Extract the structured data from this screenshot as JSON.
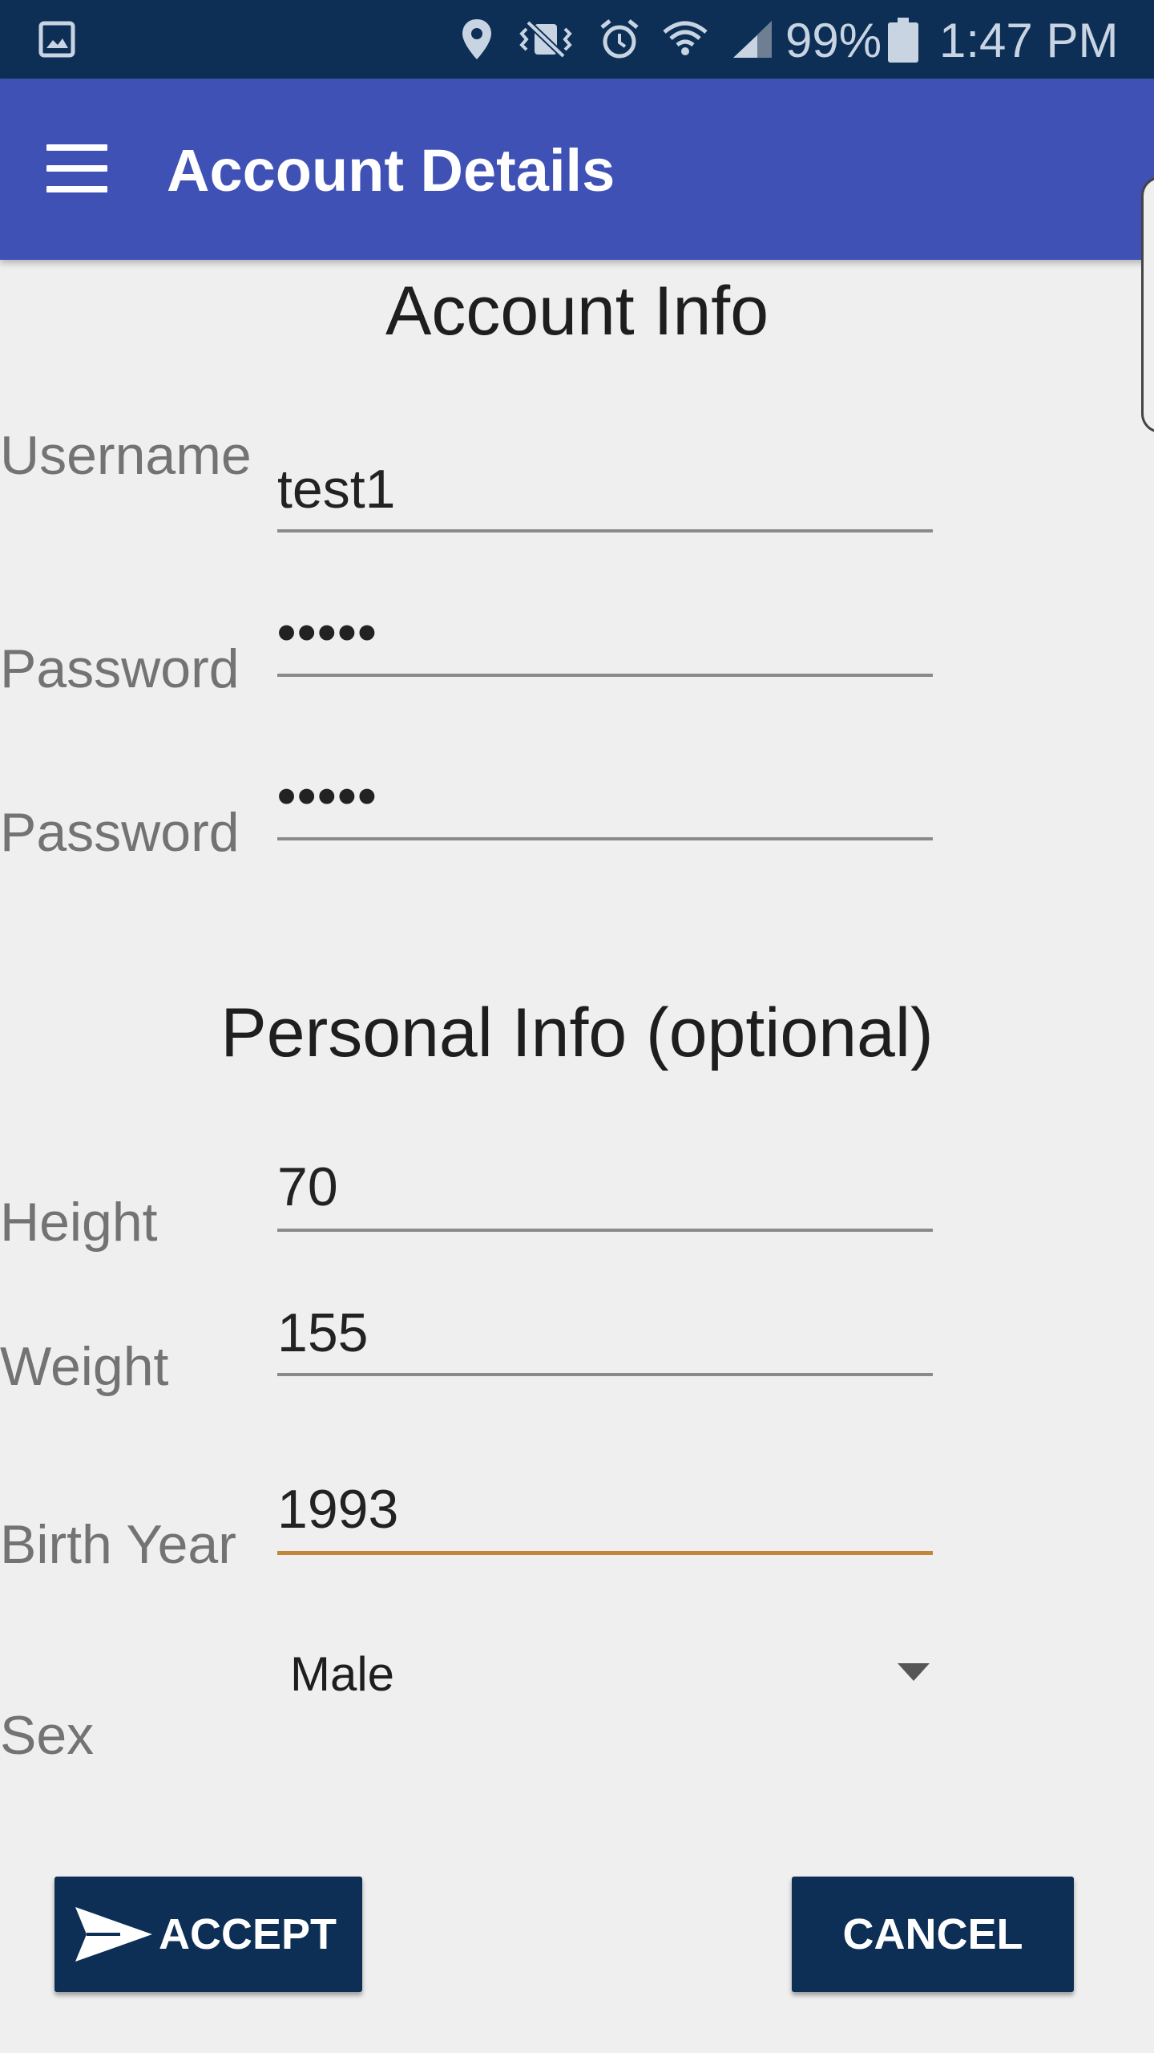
{
  "status_bar": {
    "battery_percent": "99%",
    "time": "1:47 PM",
    "icons": [
      "gallery-icon",
      "location-icon",
      "vibrate-mute-icon",
      "alarm-icon",
      "wifi-icon",
      "signal-icon",
      "battery-icon"
    ]
  },
  "app_bar": {
    "title": "Account Details",
    "background": "#3f51b5"
  },
  "account_section": {
    "title": "Account Info",
    "username_label": "Username",
    "username_value": "test1",
    "password_label": "Password",
    "password_value": "•••••",
    "confirm_label": "Password",
    "confirm_value": "•••••"
  },
  "personal_section": {
    "title": "Personal Info (optional)",
    "height_label": "Height",
    "height_value": "70",
    "weight_label": "Weight",
    "weight_value": "155",
    "birth_year_label": "Birth Year",
    "birth_year_value": "1993",
    "sex_label": "Sex",
    "sex_value": "Male"
  },
  "buttons": {
    "accept_label": "ACCEPT",
    "cancel_label": "CANCEL",
    "color": "#0d2f56"
  },
  "colors": {
    "status_bar": "#0d2f56",
    "focused_underline": "#c0873a"
  }
}
